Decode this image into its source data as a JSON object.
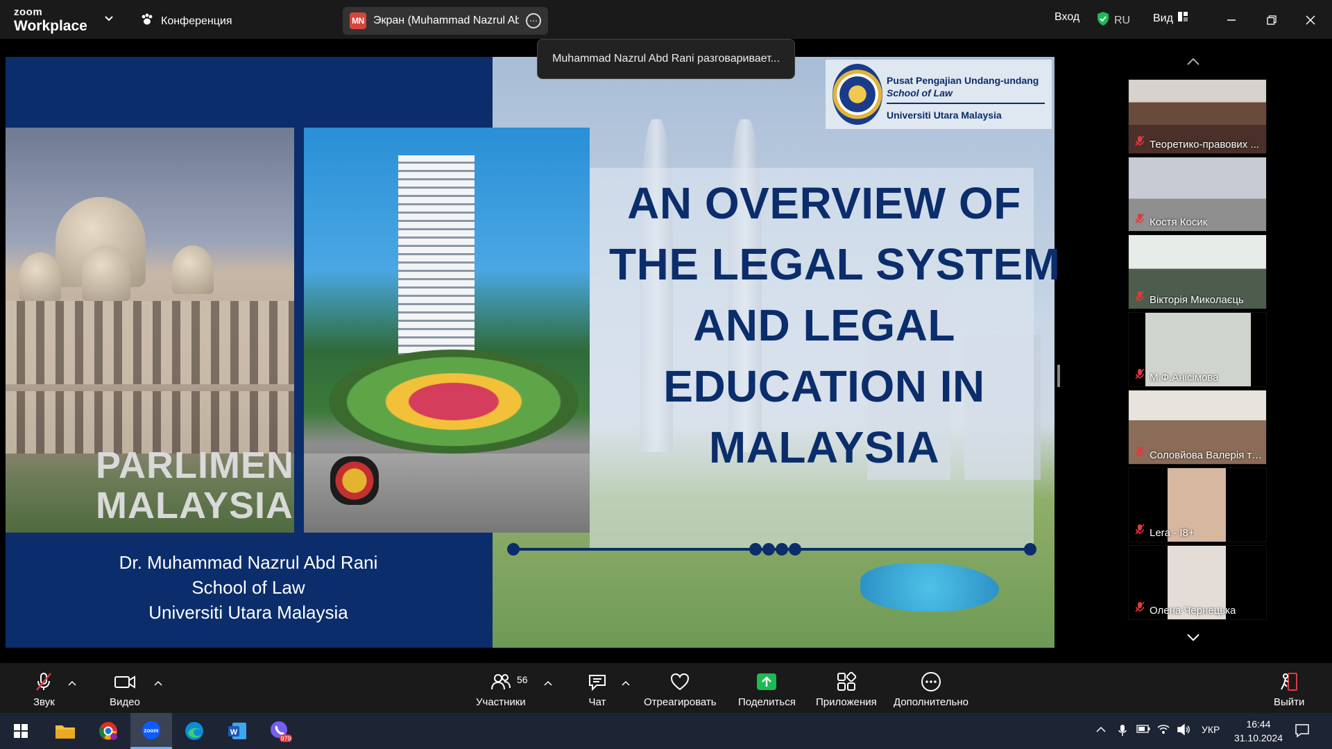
{
  "app": {
    "logo_small": "zoom",
    "logo_big": "Workplace",
    "conference_label": "Конференция",
    "share_badge": "MN",
    "share_pill_text": "Экран (Muhammad Nazrul Abd",
    "login_label": "Вход",
    "lang_label": "RU",
    "view_label": "Вид"
  },
  "tooltip": {
    "text": "Muhammad Nazrul Abd Rani разговаривает..."
  },
  "slide": {
    "brand_line1": "Pusat Pengajian Undang-undang",
    "brand_line2": "School of Law",
    "brand_line3": "Universiti Utara Malaysia",
    "title_lines": [
      "AN OVERVIEW OF",
      "THE LEGAL SYSTEM",
      "AND LEGAL",
      "EDUCATION IN",
      "MALAYSIA"
    ],
    "author_lines": [
      "Dr. Muhammad Nazrul Abd Rani",
      "School of Law",
      "Universiti Utara Malaysia"
    ],
    "photo_text1": "PARLIMEN",
    "photo_text2": "MALAYSIA"
  },
  "participants": [
    {
      "name": "Теоретико-правових ..."
    },
    {
      "name": "Костя Косик"
    },
    {
      "name": "Вікторія Миколаєць"
    },
    {
      "name": "М.Ф.Анісімова"
    },
    {
      "name": "Соловйова Валерія та ..."
    },
    {
      "name": "Lera - І8+"
    },
    {
      "name": "Олена Чернецька"
    }
  ],
  "controls": {
    "audio": "Звук",
    "video": "Видео",
    "participants": "Участники",
    "participants_count": "56",
    "chat": "Чат",
    "react": "Отреагировать",
    "share": "Поделиться",
    "apps": "Приложения",
    "more": "Дополнительно",
    "leave": "Выйти"
  },
  "taskbar": {
    "mail_badge": "979",
    "lang": "УКР",
    "time": "16:44",
    "date": "31.10.2024"
  },
  "colors": {
    "slide_navy": "#0b2d6b",
    "share_green": "#1db954",
    "muted_red": "#e0393e"
  }
}
